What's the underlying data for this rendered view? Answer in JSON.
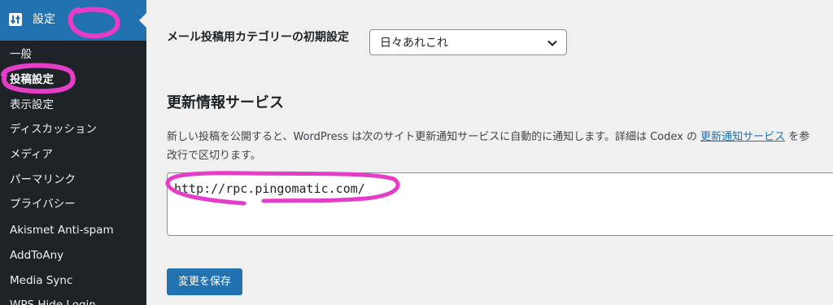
{
  "sidebar": {
    "header_label": "設定",
    "header_icon": "settings-sliders-icon",
    "items": [
      {
        "label": "一般",
        "current": false
      },
      {
        "label": "投稿設定",
        "current": true
      },
      {
        "label": "表示設定",
        "current": false
      },
      {
        "label": "ディスカッション",
        "current": false
      },
      {
        "label": "メディア",
        "current": false
      },
      {
        "label": "パーマリンク",
        "current": false
      },
      {
        "label": "プライバシー",
        "current": false
      },
      {
        "label": "Akismet Anti-spam",
        "current": false
      },
      {
        "label": "AddToAny",
        "current": false
      },
      {
        "label": "Media Sync",
        "current": false
      },
      {
        "label": "WPS Hide Login",
        "current": false
      }
    ]
  },
  "mail_category": {
    "label": "メール投稿用カテゴリーの初期設定",
    "selected": "日々あれこれ"
  },
  "update_services": {
    "title": "更新情報サービス",
    "description_line1_before": "新しい投稿を公開すると、WordPress は次のサイト更新通知サービスに自動的に通知します。詳細は Codex の ",
    "description_link": "更新通知サービス",
    "description_line1_after": " を参",
    "description_line2": "改行で区切ります。",
    "textarea_value": "http://rpc.pingomatic.com/"
  },
  "save_button": "変更を保存",
  "colors": {
    "sidebar_bg": "#1d2327",
    "accent": "#2271b1",
    "annotation": "#e63dc8"
  }
}
